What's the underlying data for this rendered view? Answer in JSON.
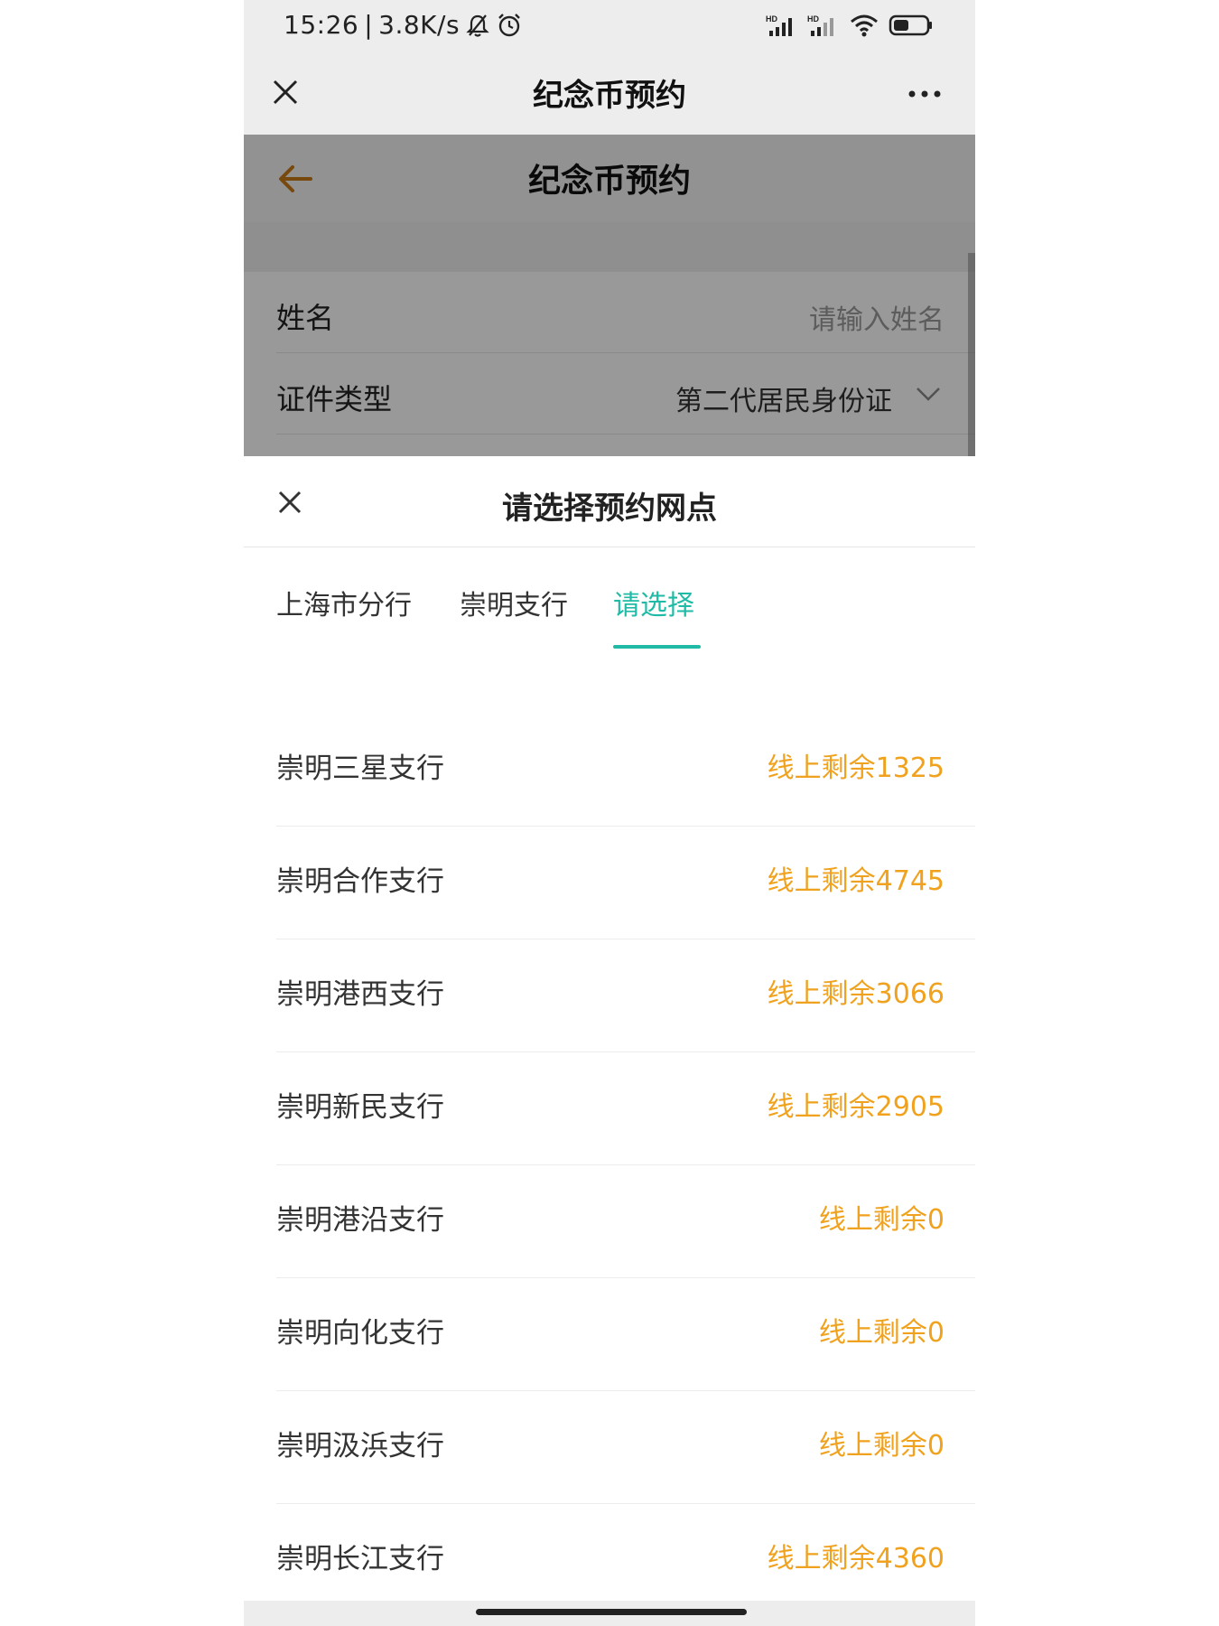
{
  "status_bar": {
    "time": "15:26",
    "speed": "3.8K/s",
    "icons": [
      "bell-off-icon",
      "alarm-icon",
      "signal-hd-icon",
      "signal-hd-icon",
      "wifi-icon",
      "battery-icon"
    ]
  },
  "navbar": {
    "title": "纪念币预约",
    "close_icon": "close-icon",
    "more_icon": "more-icon"
  },
  "page": {
    "title": "纪念币预约",
    "back_icon": "back-arrow-icon",
    "accent_color": "#c77a14",
    "form": {
      "name_label": "姓名",
      "name_placeholder": "请输入姓名",
      "id_type_label": "证件类型",
      "id_type_value": "第二代居民身份证"
    }
  },
  "sheet": {
    "title": "请选择预约网点",
    "tabs": [
      {
        "label": "上海市分行"
      },
      {
        "label": "崇明支行"
      },
      {
        "label": "请选择",
        "active": true
      }
    ],
    "active_color": "#1fbba6",
    "stock_color": "#f0a21e",
    "branches": [
      {
        "name": "崇明三星支行",
        "stock": "线上剩余1325"
      },
      {
        "name": "崇明合作支行",
        "stock": "线上剩余4745"
      },
      {
        "name": "崇明港西支行",
        "stock": "线上剩余3066"
      },
      {
        "name": "崇明新民支行",
        "stock": "线上剩余2905"
      },
      {
        "name": "崇明港沿支行",
        "stock": "线上剩余0"
      },
      {
        "name": "崇明向化支行",
        "stock": "线上剩余0"
      },
      {
        "name": "崇明汲浜支行",
        "stock": "线上剩余0"
      },
      {
        "name": "崇明长江支行",
        "stock": "线上剩余4360"
      }
    ]
  }
}
